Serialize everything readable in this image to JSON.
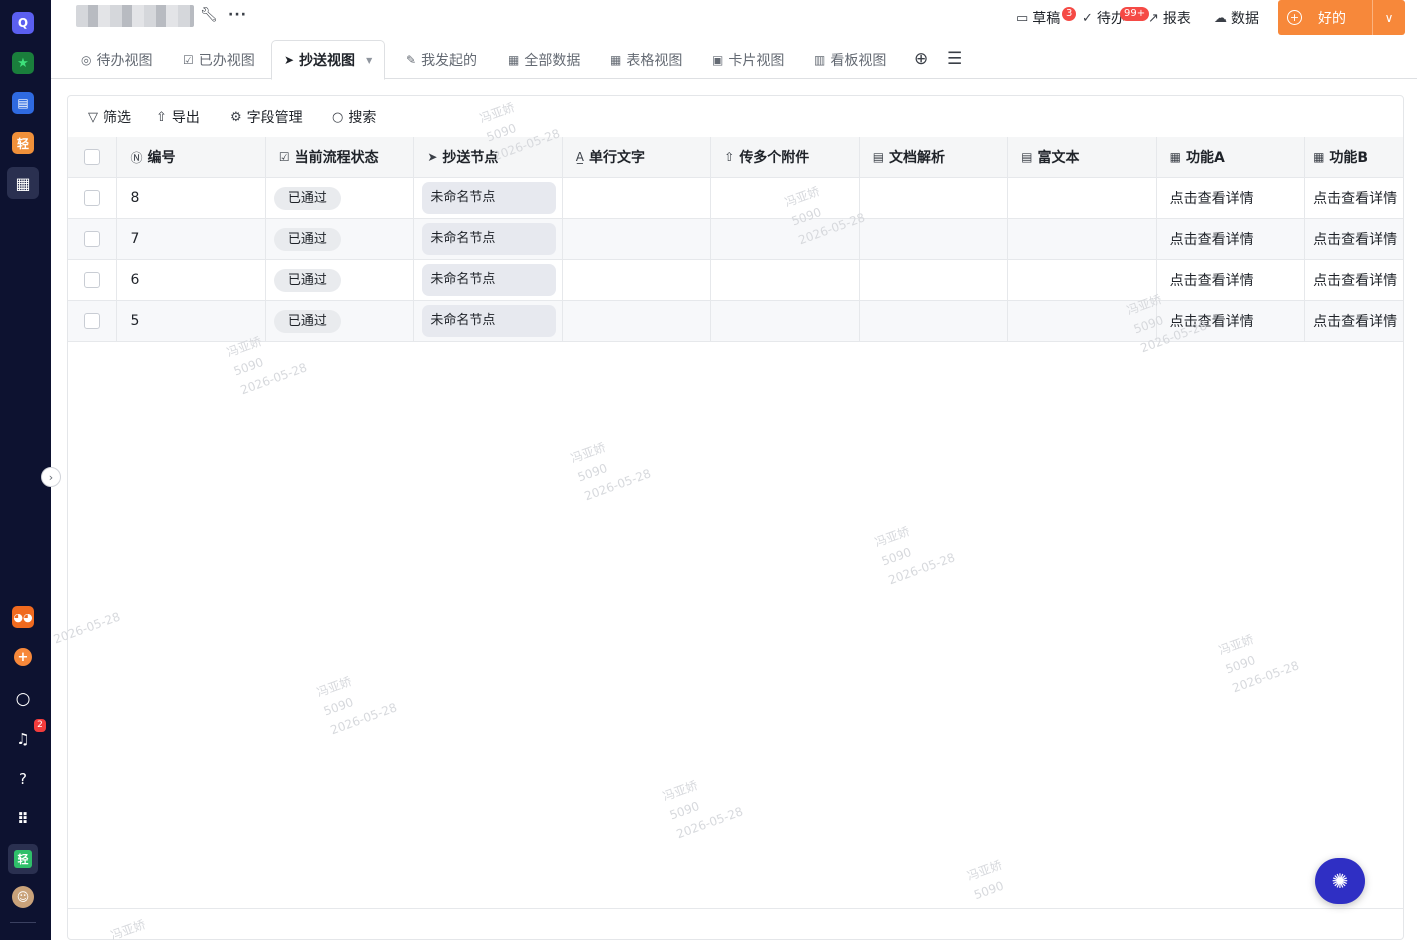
{
  "header": {
    "links": [
      {
        "label": "草稿",
        "icon": "draft-icon",
        "badge": "3"
      },
      {
        "label": "待办",
        "icon": "todo-check-icon",
        "badge": "99+"
      },
      {
        "label": "报表",
        "icon": "chart-trend-icon"
      },
      {
        "label": "数据",
        "icon": "cloud-data-icon"
      }
    ],
    "ok_button": "好的"
  },
  "tabs": [
    {
      "label": "待办视图",
      "icon": "check-circle-icon"
    },
    {
      "label": "已办视图",
      "icon": "checkbox-icon"
    },
    {
      "label": "抄送视图",
      "icon": "send-icon",
      "active": true
    },
    {
      "label": "我发起的",
      "icon": "edit-doc-icon"
    },
    {
      "label": "全部数据",
      "icon": "table-icon"
    },
    {
      "label": "表格视图",
      "icon": "table-icon"
    },
    {
      "label": "卡片视图",
      "icon": "card-icon"
    },
    {
      "label": "看板视图",
      "icon": "kanban-icon"
    }
  ],
  "toolbar": {
    "filter": "筛选",
    "export": "导出",
    "fields": "字段管理",
    "search": "搜索"
  },
  "table": {
    "columns": [
      {
        "label": "编号",
        "icon": "number-field-icon"
      },
      {
        "label": "当前流程状态",
        "icon": "checkbox-icon"
      },
      {
        "label": "抄送节点",
        "icon": "send-icon"
      },
      {
        "label": "单行文字",
        "icon": "text-field-icon"
      },
      {
        "label": "传多个附件",
        "icon": "upload-icon"
      },
      {
        "label": "文档解析",
        "icon": "document-icon"
      },
      {
        "label": "富文本",
        "icon": "rich-text-icon"
      },
      {
        "label": "功能A",
        "icon": "table-icon"
      },
      {
        "label": "功能B",
        "icon": "table-icon"
      }
    ],
    "rows": [
      {
        "id": "8",
        "status": "已通过",
        "node": "未命名节点",
        "text": "",
        "attachments": "",
        "doc": "",
        "rich": "",
        "funcA": "点击查看详情",
        "funcB": "点击查看详情"
      },
      {
        "id": "7",
        "status": "已通过",
        "node": "未命名节点",
        "text": "",
        "attachments": "",
        "doc": "",
        "rich": "",
        "funcA": "点击查看详情",
        "funcB": "点击查看详情"
      },
      {
        "id": "6",
        "status": "已通过",
        "node": "未命名节点",
        "text": "",
        "attachments": "",
        "doc": "",
        "rich": "",
        "funcA": "点击查看详情",
        "funcB": "点击查看详情"
      },
      {
        "id": "5",
        "status": "已通过",
        "node": "未命名节点",
        "text": "",
        "attachments": "",
        "doc": "",
        "rich": "",
        "funcA": "点击查看详情",
        "funcB": "点击查看详情"
      }
    ]
  },
  "sidebar": {
    "notification_badge": "2"
  },
  "watermark": {
    "name": "冯亚娇",
    "code": "5090",
    "date": "2026-05-28"
  },
  "colors": {
    "accent": "#f7883a",
    "rail": "#0d1230",
    "badge": "#f54a45"
  }
}
